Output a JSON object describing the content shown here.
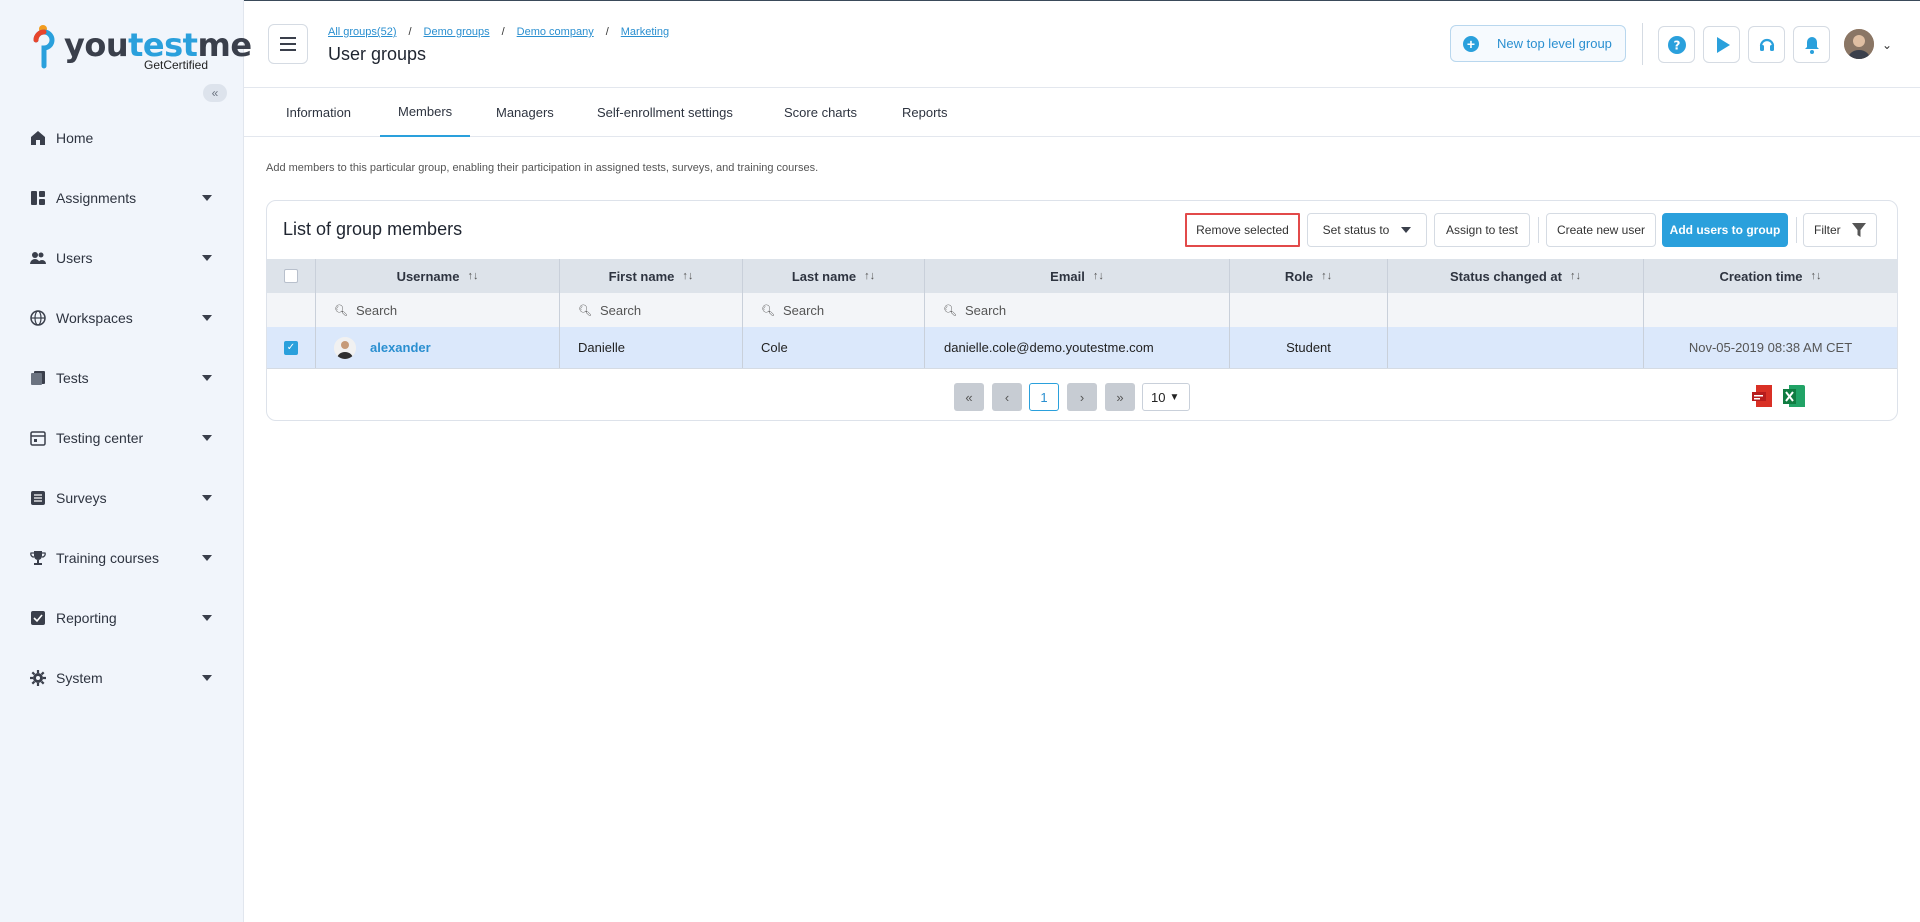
{
  "app": {
    "logo_text_left": "you",
    "logo_text_mid": "test",
    "logo_text_right": "me",
    "logo_sub": "GetCertified",
    "brand_color": "#2aa0dc"
  },
  "sidebar": {
    "items": [
      {
        "label": "Home",
        "icon": "home-icon",
        "has_caret": false
      },
      {
        "label": "Assignments",
        "icon": "assignments-icon",
        "has_caret": true
      },
      {
        "label": "Users",
        "icon": "users-icon",
        "has_caret": true
      },
      {
        "label": "Workspaces",
        "icon": "globe-icon",
        "has_caret": true
      },
      {
        "label": "Tests",
        "icon": "tests-icon",
        "has_caret": true
      },
      {
        "label": "Testing center",
        "icon": "calendar-icon",
        "has_caret": true
      },
      {
        "label": "Surveys",
        "icon": "survey-icon",
        "has_caret": true
      },
      {
        "label": "Training courses",
        "icon": "trophy-icon",
        "has_caret": true
      },
      {
        "label": "Reporting",
        "icon": "report-icon",
        "has_caret": true
      },
      {
        "label": "System",
        "icon": "gear-icon",
        "has_caret": true
      }
    ]
  },
  "header": {
    "breadcrumb": [
      "All groups(52)",
      "Demo groups",
      "Demo company",
      "Marketing"
    ],
    "breadcrumb_sep": "/",
    "title": "User groups",
    "new_group_label": "New top level group"
  },
  "tabs": [
    "Information",
    "Members",
    "Managers",
    "Self-enrollment settings",
    "Score charts",
    "Reports"
  ],
  "active_tab": "Members",
  "description": "Add members to this particular group, enabling their participation in assigned tests, surveys, and training courses.",
  "card": {
    "title": "List of group members",
    "remove_selected": "Remove selected",
    "set_status": "Set status to",
    "assign_to_test": "Assign to test",
    "create_new_user": "Create new user",
    "add_users": "Add users to group",
    "filter": "Filter"
  },
  "table": {
    "columns": [
      "Username",
      "First name",
      "Last name",
      "Email",
      "Role",
      "Status changed at",
      "Creation time"
    ],
    "search_placeholder": "Search",
    "rows": [
      {
        "selected": true,
        "username": "alexander",
        "first_name": "Danielle",
        "last_name": "Cole",
        "email": "danielle.cole@demo.youtestme.com",
        "role": "Student",
        "status_changed_at": "",
        "creation_time": "Nov-05-2019 08:38 AM CET"
      }
    ]
  },
  "pager": {
    "current_page": "1",
    "page_size": "10"
  }
}
